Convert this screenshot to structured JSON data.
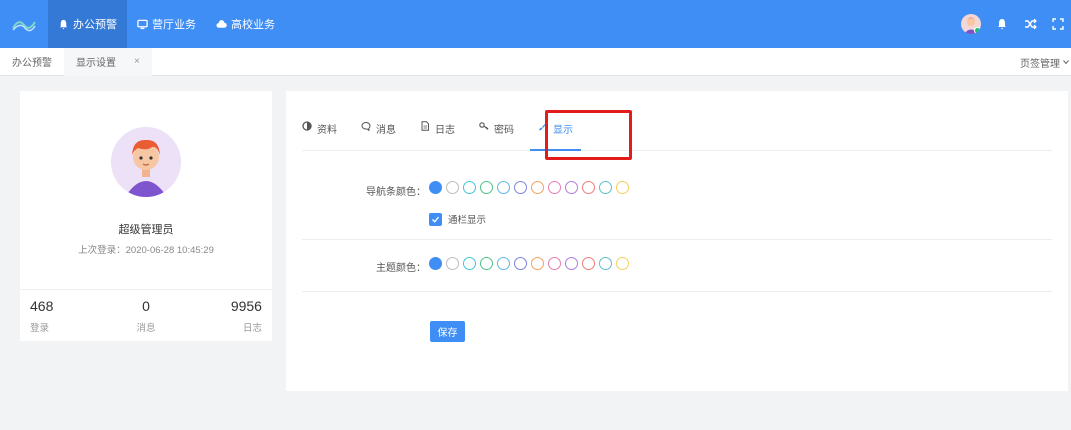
{
  "header": {
    "nav": [
      {
        "label": "办公预警",
        "icon": "bell-icon",
        "active": true
      },
      {
        "label": "营厅业务",
        "icon": "monitor-icon",
        "active": false
      },
      {
        "label": "高校业务",
        "icon": "cloud-icon",
        "active": false
      }
    ]
  },
  "tabs": {
    "items": [
      {
        "label": "办公预警",
        "active": false
      },
      {
        "label": "显示设置",
        "active": true,
        "close": "×"
      }
    ],
    "manage_label": "页签管理"
  },
  "profile": {
    "name": "超级管理员",
    "last_login": "上次登录：2020-06-28 10:45:29",
    "stats": [
      {
        "value": "468",
        "label": "登录"
      },
      {
        "value": "0",
        "label": "消息"
      },
      {
        "value": "9956",
        "label": "日志"
      }
    ]
  },
  "settings": {
    "tabs": [
      {
        "label": "资料",
        "icon": "half-circle-icon"
      },
      {
        "label": "消息",
        "icon": "chat-bubble-icon"
      },
      {
        "label": "日志",
        "icon": "document-icon"
      },
      {
        "label": "密码",
        "icon": "key-icon"
      },
      {
        "label": "显示",
        "icon": "brush-icon",
        "active": true
      }
    ],
    "nav_color_label": "导航条颜色：",
    "column_display_label": "通栏显示",
    "theme_color_label": "主题颜色：",
    "save_label": "保存",
    "palette": [
      "#3f8ef5",
      "#bdbdbd",
      "#3fc6d8",
      "#4cc48a",
      "#5fb8e8",
      "#7c83e0",
      "#f0a35e",
      "#e87bb4",
      "#b07ae0",
      "#f07c7c",
      "#5bc0c8",
      "#f3d05b"
    ]
  }
}
